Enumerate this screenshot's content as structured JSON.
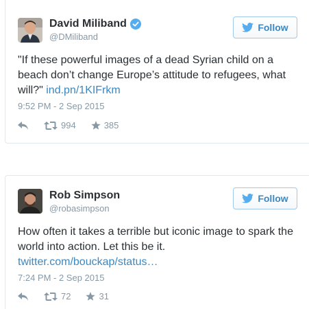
{
  "tweets": [
    {
      "display_name": "David Miliband",
      "handle": "@DMiliband",
      "verified": true,
      "follow_label": "Follow",
      "text": "\"If these powerful images of a dead Syrian child on a beach don’t change Europe’s attitude to refugees, what will?\" ",
      "link": "ind.pn/1KIFrkm",
      "timestamp": "9:52 PM - 2 Sep 2015",
      "retweets": "994",
      "favorites": "385"
    },
    {
      "display_name": "Rob Simpson",
      "handle": "@robasimpson",
      "verified": false,
      "follow_label": "Follow",
      "text": "How often it takes a terrible but iconic image to spark the world into action. Let this be it. ",
      "link": "twitter.com/bouckap/status…",
      "timestamp": "7:24 PM - 2 Sep 2015",
      "retweets": "72",
      "favorites": "31"
    }
  ],
  "colors": {
    "link": "#3b88c3",
    "muted": "#8899a6",
    "text": "#292f33",
    "border": "#e1e8ed",
    "verified": "#55acee"
  },
  "icons": {
    "reply": "reply-icon",
    "retweet": "retweet-icon",
    "favorite": "star-icon",
    "follow": "twitter-bird-icon"
  }
}
